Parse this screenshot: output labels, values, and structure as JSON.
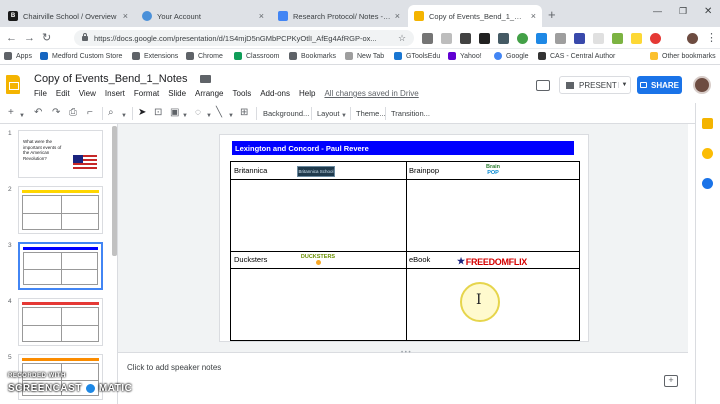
{
  "browser": {
    "tabs": [
      {
        "label": "Chairville School / Overview",
        "icon": "blackboard-icon",
        "color": "#1a1a1a"
      },
      {
        "label": "Your Account",
        "icon": "account-icon",
        "color": "#4a90d9"
      },
      {
        "label": "Research Protocol/ Notes - Tean",
        "icon": "docs-icon",
        "color": "#4285f4"
      },
      {
        "label": "Copy of Events_Bend_1_Notes - (",
        "icon": "slides-icon",
        "color": "#f4b400"
      }
    ],
    "url": "https://docs.google.com/presentation/d/1S4mjD5nGMbPCPKyOtlI_AfEg4AfRGP-ox...",
    "bookmarks": [
      {
        "label": "Apps",
        "color": "#5f6368"
      },
      {
        "label": "Medford Custom Store",
        "color": "#1565c0"
      },
      {
        "label": "Extensions",
        "color": "#5f6368"
      },
      {
        "label": "Chrome",
        "color": "#5f6368"
      },
      {
        "label": "Classroom",
        "color": "#0f9d58"
      },
      {
        "label": "Bookmarks",
        "color": "#5f6368"
      },
      {
        "label": "New Tab",
        "color": "#9e9e9e"
      },
      {
        "label": "GToolsEdu",
        "color": "#1976d2"
      },
      {
        "label": "Yahoo!",
        "color": "#6001d2"
      },
      {
        "label": "Google",
        "color": "#4285f4"
      },
      {
        "label": "CAS - Central Author",
        "color": "#333333"
      }
    ],
    "other_bookmarks": "Other bookmarks"
  },
  "doc": {
    "title": "Copy of Events_Bend_1_Notes",
    "menu": [
      "File",
      "Edit",
      "View",
      "Insert",
      "Format",
      "Slide",
      "Arrange",
      "Tools",
      "Add-ons",
      "Help"
    ],
    "saved_status": "All changes saved in Drive",
    "present_label": "PRESENT",
    "share_label": "SHARE"
  },
  "toolbar": {
    "background": "Background...",
    "layout": "Layout",
    "theme": "Theme...",
    "transition": "Transition..."
  },
  "filmstrip": {
    "slides": [
      {
        "num": "1",
        "text": "What were the important events of the American Revolution?"
      },
      {
        "num": "2",
        "band": "#ffd600"
      },
      {
        "num": "3",
        "band": "#0000ff"
      },
      {
        "num": "4",
        "band": "#e53935"
      },
      {
        "num": "5",
        "band": "#fb8c00"
      }
    ]
  },
  "slide": {
    "title": "Lexington and Concord - Paul Revere",
    "cells": [
      "Britannica",
      "Brainpop",
      "Ducksters",
      "eBook"
    ],
    "logos": {
      "britannica": "Britannica School",
      "brainpop_top": "Brain",
      "brainpop_bottom": "POP",
      "ducksters": "DUCKSTERS",
      "freedomflix": "FREEDOMFLIX"
    }
  },
  "notes": {
    "placeholder": "Click to add speaker notes"
  },
  "watermark": {
    "line1": "RECORDED WITH",
    "line2a": "SCREENCAST",
    "line2b": "MATIC"
  }
}
